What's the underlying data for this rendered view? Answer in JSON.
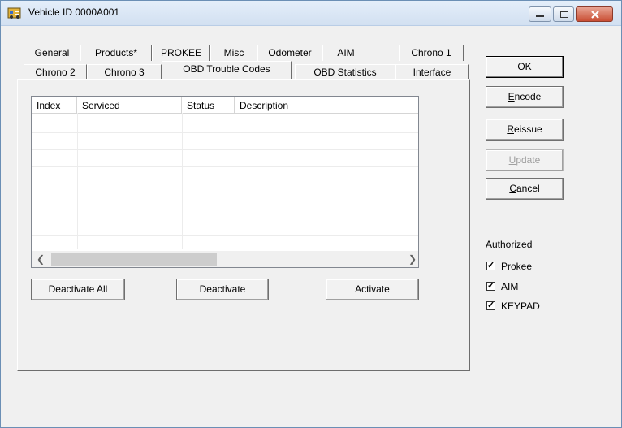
{
  "window": {
    "title": "Vehicle ID 0000A001"
  },
  "tabs_row1": [
    {
      "label": "General"
    },
    {
      "label": "Products*"
    },
    {
      "label": "PROKEE"
    },
    {
      "label": "Misc"
    },
    {
      "label": "Odometer"
    },
    {
      "label": "AIM"
    },
    {
      "label": "Chrono 1"
    }
  ],
  "tabs_row2": [
    {
      "label": "Chrono 2"
    },
    {
      "label": "Chrono 3"
    },
    {
      "label": "OBD Trouble Codes"
    },
    {
      "label": "OBD Statistics"
    },
    {
      "label": "Interface"
    }
  ],
  "active_tab": "OBD Trouble Codes",
  "table": {
    "columns": [
      "Index",
      "Serviced",
      "Status",
      "Description"
    ],
    "rows": []
  },
  "panel_buttons": {
    "deactivate_all": "Deactivate All",
    "deactivate": "Deactivate",
    "activate": "Activate"
  },
  "side_buttons": {
    "ok": {
      "hot": "O",
      "rest": "K"
    },
    "encode": {
      "hot": "E",
      "rest": "ncode"
    },
    "reissue": {
      "hot": "R",
      "rest": "eissue"
    },
    "update": {
      "hot": "U",
      "rest": "pdate"
    },
    "cancel": {
      "hot": "C",
      "rest": "ancel"
    }
  },
  "authorized": {
    "title": "Authorized",
    "items": [
      {
        "label": "Prokee",
        "checked": true
      },
      {
        "label": "AIM",
        "checked": true
      },
      {
        "label": "KEYPAD",
        "checked": true
      }
    ]
  }
}
